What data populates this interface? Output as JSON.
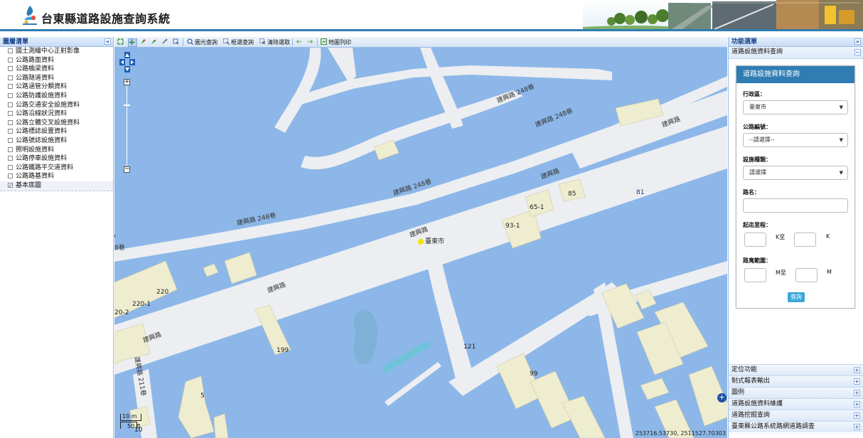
{
  "header": {
    "title": "台東縣道路設施查詢系統"
  },
  "left_panel": {
    "title": "圖層清單",
    "layers": [
      {
        "label": "國土測繪中心正射影像",
        "checked": false
      },
      {
        "label": "公路路面資料",
        "checked": false
      },
      {
        "label": "公路橋梁資料",
        "checked": false
      },
      {
        "label": "公路隧道資料",
        "checked": false
      },
      {
        "label": "公路涵管分類資料",
        "checked": false
      },
      {
        "label": "公路防護設施資料",
        "checked": false
      },
      {
        "label": "公路交通安全設施資料",
        "checked": false
      },
      {
        "label": "公路沿線狀況資料",
        "checked": false
      },
      {
        "label": "公路立體交叉設施資料",
        "checked": false
      },
      {
        "label": "公路標誌設置資料",
        "checked": false
      },
      {
        "label": "公路號誌設施資料",
        "checked": false
      },
      {
        "label": "照明設施資料",
        "checked": false
      },
      {
        "label": "公路停車設施資料",
        "checked": false
      },
      {
        "label": "公路鐵路平交道資料",
        "checked": false
      },
      {
        "label": "公路路基資料",
        "checked": false
      },
      {
        "label": "基本底圖",
        "checked": true
      }
    ]
  },
  "toolbar": {
    "circle_query": "圓元查詢",
    "box_query": "框選查詢",
    "clear_selection": "清除選取",
    "print_map": "地圖列印"
  },
  "map": {
    "labels": {
      "lane_248_a": "建興路 248巷",
      "lane_248_b": "建興路 248巷",
      "lane_248_c": "建興路 248巷",
      "lane_248_d": "建興路 248巷",
      "road_a": "建興路",
      "road_b": "建興路",
      "road_c": "建興路",
      "road_d": "建興路",
      "road_e": "建興路",
      "lane_211": "建興路 211巷",
      "lane_left": "8巷",
      "city": "臺東市"
    },
    "numbers": {
      "n81": "81",
      "n85": "85",
      "n65_1": "65-1",
      "n93_1": "93-1",
      "n220": "220",
      "n220_1": "220-1",
      "n20_2": "20-2",
      "n199": "199",
      "n121": "121",
      "n99": "99",
      "n5": "5",
      "n10": "10"
    },
    "scale": {
      "top": "10 m",
      "bottom": "50 ft"
    },
    "coordinates": "253716.53730, 2511527.70303"
  },
  "right_panel": {
    "title": "功能選單",
    "section_title": "道路設施資料查詢",
    "form": {
      "title": "道路設施資料查詢",
      "district_label": "行政區：",
      "district_value": "臺東市",
      "road_grade_label": "公路編號：",
      "road_grade_value": "--請選擇--",
      "facility_label": "設施種類：",
      "facility_value": "請選擇",
      "road_name_label": "路名：",
      "mileage_label": "起迄里程：",
      "mileage_unit_from": "K至",
      "mileage_unit_to": "K",
      "road_range_label": "路寬範圍：",
      "range_unit_from": "M至",
      "range_unit_to": "M",
      "query_button": "查詢"
    },
    "accordion": [
      "定位功能",
      "制式報表輸出",
      "圖例",
      "道路設施資料維護",
      "道路挖掘查詢",
      "臺東縣公路系統路網道路調查"
    ]
  },
  "colors": {
    "accent": "#2f7db3",
    "water": "#8db7e8",
    "land": "#e9ecf0",
    "building": "#efedd0"
  }
}
